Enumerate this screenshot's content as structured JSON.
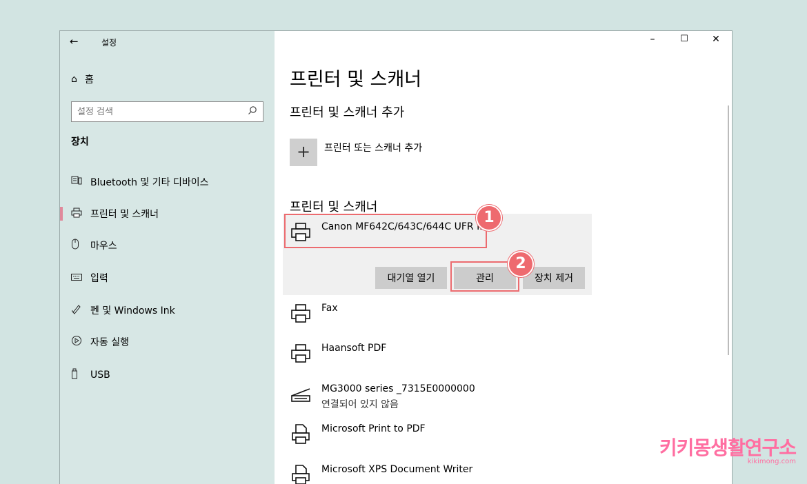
{
  "window": {
    "back_icon": "back-arrow-icon",
    "title": "설정",
    "controls": [
      "–",
      "☐",
      "✕"
    ]
  },
  "sidebar": {
    "home_label": "홈",
    "search_placeholder": "설정 검색",
    "section": "장치",
    "items": [
      {
        "label": "Bluetooth 및 기타 디바이스",
        "icon": "bluetooth-device-icon"
      },
      {
        "label": "프린터 및 스캐너",
        "icon": "printer-icon",
        "active": true
      },
      {
        "label": "마우스",
        "icon": "mouse-icon"
      },
      {
        "label": "입력",
        "icon": "keyboard-icon"
      },
      {
        "label": "펜 및 Windows Ink",
        "icon": "pen-icon"
      },
      {
        "label": "자동 실행",
        "icon": "autoplay-icon"
      },
      {
        "label": "USB",
        "icon": "usb-icon"
      }
    ]
  },
  "main": {
    "page_title": "프린터 및 스캐너",
    "add_section_title": "프린터 및 스캐너 추가",
    "add_label": "프린터 또는 스캐너 추가",
    "list_title": "프린터 및 스캐너",
    "devices": [
      {
        "name": "Canon MF642C/643C/644C UFR II",
        "icon": "printer-icon",
        "selected": true
      },
      {
        "name": "Fax",
        "icon": "printer-icon"
      },
      {
        "name": "Haansoft PDF",
        "icon": "printer-icon"
      },
      {
        "name": "MG3000 series _7315E0000000",
        "sub": "연결되어 있지 않음",
        "icon": "scanner-icon"
      },
      {
        "name": "Microsoft Print to PDF",
        "icon": "document-printer-icon"
      },
      {
        "name": "Microsoft XPS Document Writer",
        "icon": "document-printer-icon"
      }
    ],
    "actions": {
      "queue": "대기열 열기",
      "manage": "관리",
      "remove": "장치 제거"
    }
  },
  "annotations": {
    "badge1": "1",
    "badge2": "2",
    "accent": "#ec6b6f"
  },
  "watermark": {
    "main": "키키몽생활연구소",
    "sub": "kikimong.com"
  }
}
